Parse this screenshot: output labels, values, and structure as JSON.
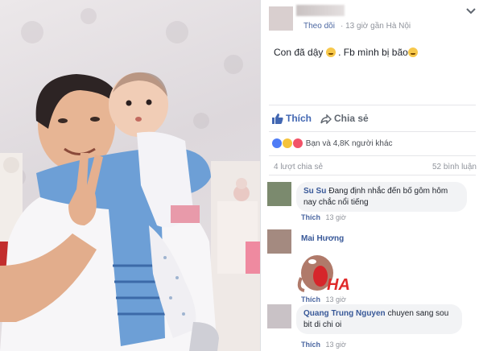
{
  "post": {
    "header": {
      "follow_label": "Theo dõi",
      "meta": "· 13 giờ gần Hà Nội",
      "menu_icon": "chevron-down-icon"
    },
    "text": "Con đã dậy",
    "text_suffix": ". Fb mình bị bão",
    "actions": {
      "like_label": "Thích",
      "share_label": "Chia sẻ"
    },
    "reactions_text": "Bạn và 4,8K người khác",
    "shares_text": "4 lượt chia sẻ",
    "comments_count_text": "52 bình luận"
  },
  "comments": [
    {
      "name": "Su Su",
      "text": "Đang định nhắc đến bố gôm hôm nay chắc nổi tiếng",
      "like_label": "Thích",
      "time": "13 giờ"
    },
    {
      "name": "Mai Hương",
      "sticker_text": "HA",
      "like_label": "Thích",
      "time": "13 giờ"
    },
    {
      "name": "Quang Trung Nguyen",
      "text": "chuyen sang sou bit di chi oi",
      "like_label": "Thích",
      "time": "13 giờ"
    }
  ],
  "colors": {
    "link_blue": "#4267b2",
    "name_blue": "#385898",
    "muted_gray": "#90949c",
    "bubble_bg": "#f2f3f5"
  }
}
